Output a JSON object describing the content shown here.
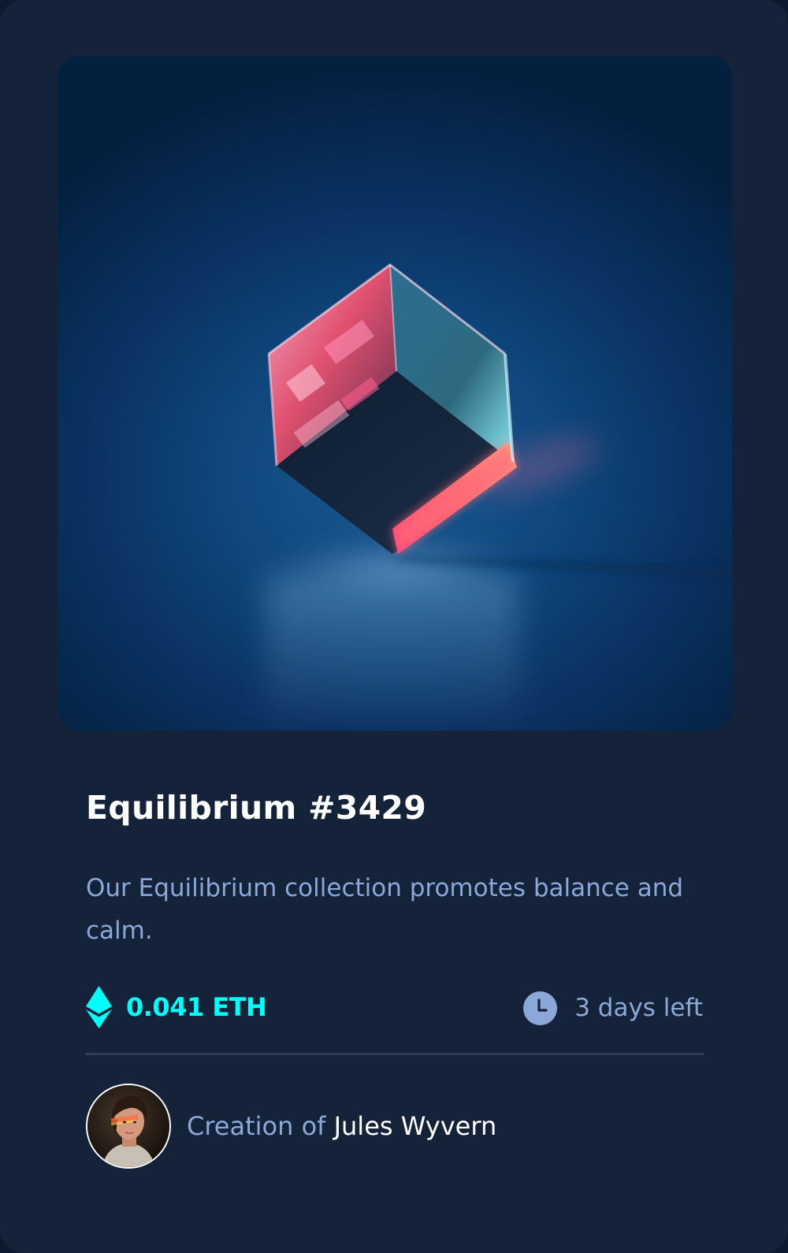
{
  "nft": {
    "title": "Equilibrium #3429",
    "description": "Our Equilibrium collection promotes balance and calm.",
    "price": "0.041 ETH",
    "time_left": "3 days left",
    "creator_prefix": "Creation of",
    "creator_name": "Jules Wyvern",
    "image_icon": "equilibrium-cube-image",
    "price_icon": "ethereum-icon",
    "time_icon": "clock-icon"
  },
  "colors": {
    "card_bg": "#15233a",
    "page_bg": "#0d1a2d",
    "accent_cyan": "#00fff8",
    "soft_blue_text": "#8ba8d8",
    "white": "#ffffff",
    "divider": "#2f3d55"
  }
}
